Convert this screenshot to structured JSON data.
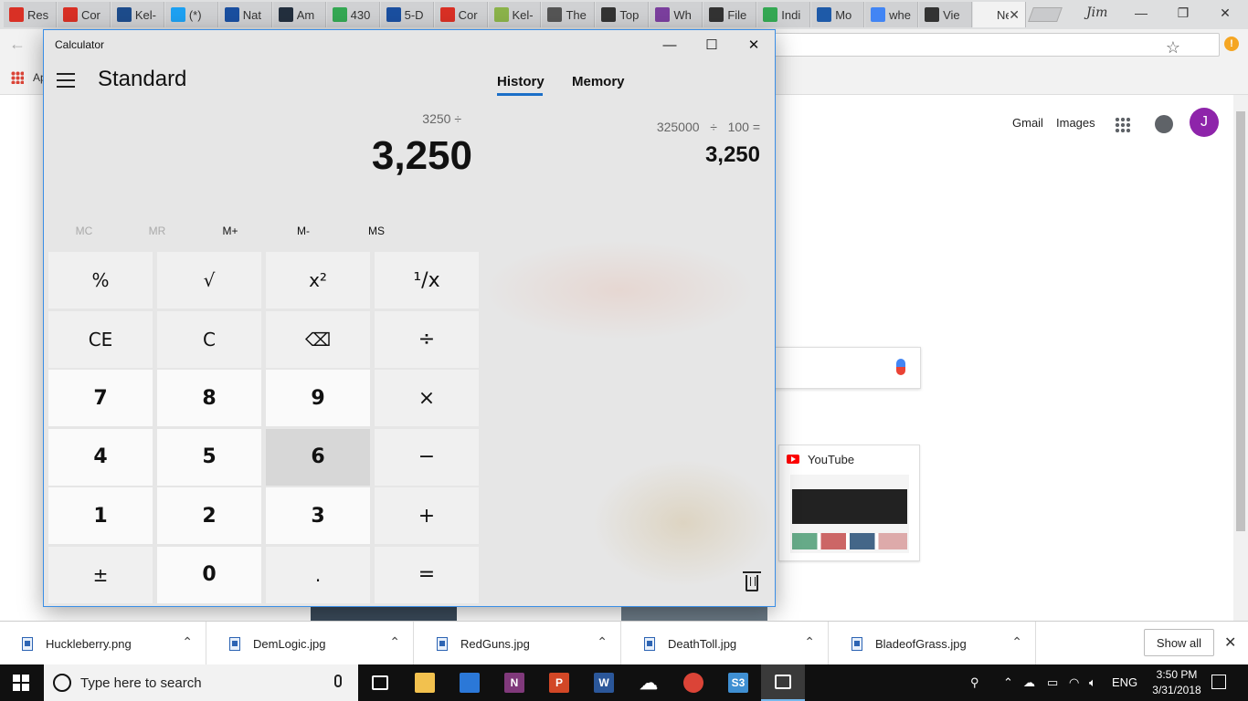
{
  "browser": {
    "tabs": [
      {
        "label": "Res",
        "icon": "gmail-icon",
        "color": "#d93025"
      },
      {
        "label": "Cor",
        "icon": "gmail-icon",
        "color": "#d93025"
      },
      {
        "label": "Kel-",
        "icon": "kel-icon",
        "color": "#1d4c8c"
      },
      {
        "label": "(*) ",
        "icon": "twitter-icon",
        "color": "#1da1f2"
      },
      {
        "label": "Nat",
        "icon": "weather-channel-icon",
        "color": "#1a4fa0"
      },
      {
        "label": "Am",
        "icon": "amazon-icon",
        "color": "#232f3e"
      },
      {
        "label": "430",
        "icon": "maps-icon",
        "color": "#34a853"
      },
      {
        "label": "5-D",
        "icon": "weather-channel-icon",
        "color": "#1a4fa0"
      },
      {
        "label": "Cor",
        "icon": "gmail-icon",
        "color": "#d93025"
      },
      {
        "label": "Kel-",
        "icon": "gun-icon",
        "color": "#8bb34a"
      },
      {
        "label": "The",
        "icon": "im-icon",
        "color": "#555555"
      },
      {
        "label": "Top",
        "icon": "wikipedia-icon",
        "color": "#333333"
      },
      {
        "label": "Wh",
        "icon": "slate-icon",
        "color": "#7b3f9e"
      },
      {
        "label": "File",
        "icon": "wikipedia-icon",
        "color": "#333333"
      },
      {
        "label": "Indi",
        "icon": "maps-icon",
        "color": "#34a853"
      },
      {
        "label": "Mo",
        "icon": "lp-icon",
        "color": "#1e5aa8"
      },
      {
        "label": "whe",
        "icon": "google-icon",
        "color": "#4285f4"
      },
      {
        "label": "Vie",
        "icon": "tripadvisor-icon",
        "color": "#333333"
      },
      {
        "label": "Nev",
        "icon": "newtab-icon",
        "color": "#f2f2f2",
        "active": true
      }
    ],
    "profile_label": "Jim",
    "bookmarks_apps_label": "Ap"
  },
  "google_page": {
    "gmail": "Gmail",
    "images": "Images",
    "avatar_letter": "J",
    "tile_title": "YouTube"
  },
  "calculator": {
    "window_title": "Calculator",
    "mode": "Standard",
    "tab_history": "History",
    "tab_memory": "Memory",
    "expression": "3250 ÷",
    "display": "3,250",
    "memory_buttons": [
      {
        "label": "MC",
        "enabled": false
      },
      {
        "label": "MR",
        "enabled": false
      },
      {
        "label": "M+",
        "enabled": true
      },
      {
        "label": "M-",
        "enabled": true
      },
      {
        "label": "MS",
        "enabled": true
      }
    ],
    "keys": [
      [
        "%",
        "√",
        "x²",
        "¹/x"
      ],
      [
        "CE",
        "C",
        "⌫",
        "÷"
      ],
      [
        "7",
        "8",
        "9",
        "×"
      ],
      [
        "4",
        "5",
        "6",
        "−"
      ],
      [
        "1",
        "2",
        "3",
        "+"
      ],
      [
        "±",
        "0",
        ".",
        "="
      ]
    ],
    "history_expression": "325000   ÷   100 =",
    "history_result": "3,250"
  },
  "downloads": {
    "items": [
      "Huckleberry.png",
      "DemLogic.jpg",
      "RedGuns.jpg",
      "DeathToll.jpg",
      "BladeofGrass.jpg"
    ],
    "show_all": "Show all"
  },
  "taskbar": {
    "search_placeholder": "Type here to search",
    "apps": [
      {
        "name": "task-view-icon",
        "label": "",
        "color": "#101010"
      },
      {
        "name": "file-explorer-icon",
        "label": "",
        "color": "#f2c14e"
      },
      {
        "name": "store-icon",
        "label": "",
        "color": "#2b78d8"
      },
      {
        "name": "onenote-icon",
        "label": "N",
        "color": "#80397b"
      },
      {
        "name": "powerpoint-icon",
        "label": "P",
        "color": "#d24726"
      },
      {
        "name": "word-icon",
        "label": "W",
        "color": "#2b579a"
      },
      {
        "name": "onedrive-icon",
        "label": "",
        "color": "#101010"
      },
      {
        "name": "chrome-icon",
        "label": "",
        "color": "#db4437"
      },
      {
        "name": "s3-icon",
        "label": "S3",
        "color": "#3f8fd2"
      },
      {
        "name": "calculator-icon",
        "label": "",
        "color": "#3a3a3a",
        "active": true
      }
    ],
    "language": "ENG",
    "time": "3:50 PM",
    "date": "3/31/2018"
  }
}
